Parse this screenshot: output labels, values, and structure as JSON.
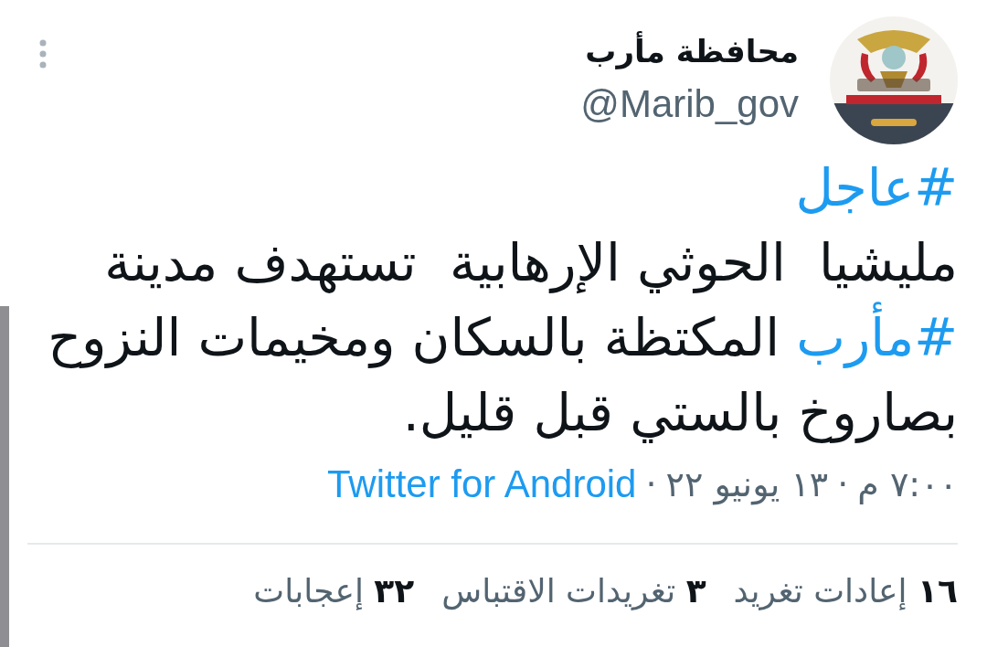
{
  "author": {
    "name": "محافظة مأرب",
    "handle": "@Marib_gov"
  },
  "tweet": {
    "lines": [
      [
        {
          "kind": "hashtag",
          "text": "#عاجل"
        }
      ],
      [
        {
          "kind": "text",
          "text": "مليشيا  الحوثي الإرهابية  تستهدف مدينة"
        }
      ],
      [
        {
          "kind": "hashtag",
          "text": "#مأرب"
        },
        {
          "kind": "text",
          "text": " المكتظة بالسكان ومخيمات النزوح"
        }
      ],
      [
        {
          "kind": "text",
          "text": "بصاروخ بالستي قبل قليل."
        }
      ]
    ]
  },
  "meta": {
    "time": "٧:٠٠ م",
    "separator": "·",
    "date": "١٣ يونيو ٢٢",
    "source": "Twitter for Android"
  },
  "stats": [
    {
      "count": "١٦",
      "label": "إعادات تغريد"
    },
    {
      "count": "٣",
      "label": "تغريدات الاقتباس"
    },
    {
      "count": "٣٢",
      "label": "إعجابات"
    }
  ]
}
